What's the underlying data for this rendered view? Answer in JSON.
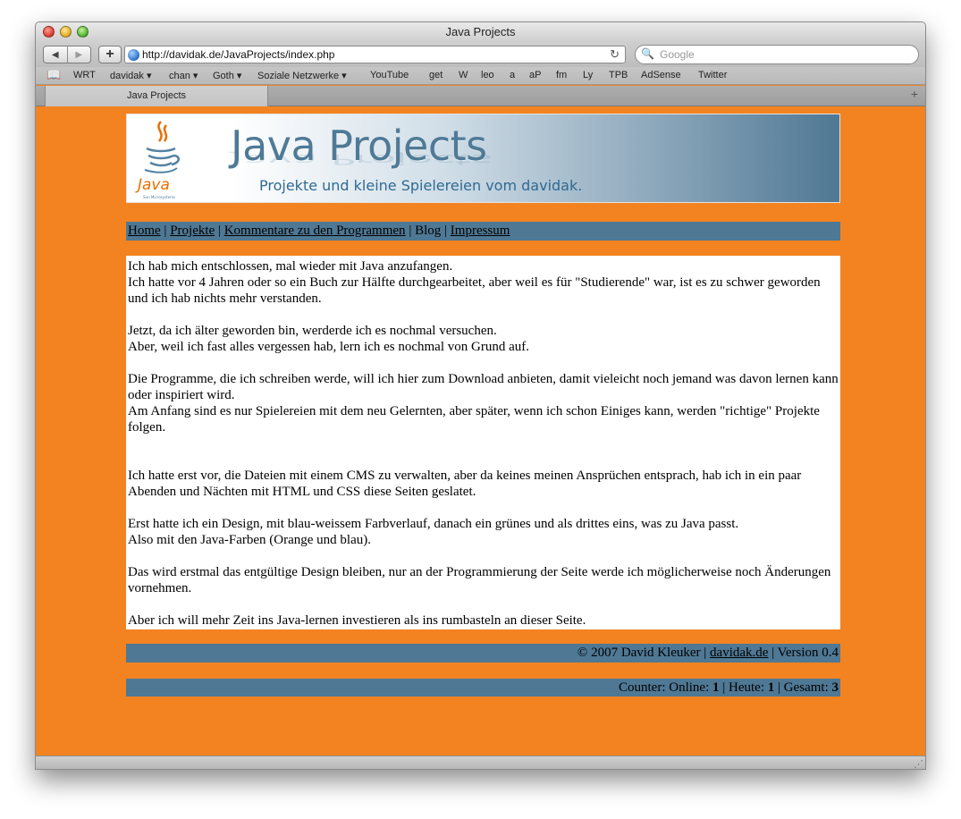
{
  "window": {
    "title": "Java Projects"
  },
  "toolbar": {
    "back_icon": "◀",
    "forward_icon": "▶",
    "add_icon": "+",
    "url": "http://davidak.de/JavaProjects/index.php",
    "reload_icon": "↻",
    "search_placeholder": "Google"
  },
  "bookmarks": [
    {
      "label": "WRT"
    },
    {
      "label": "davidak ▾"
    },
    {
      "label": "chan ▾"
    },
    {
      "label": "Goth ▾"
    },
    {
      "label": "Soziale Netzwerke ▾"
    },
    {
      "label": "YouTube"
    },
    {
      "label": "get"
    },
    {
      "label": "W"
    },
    {
      "label": "leo"
    },
    {
      "label": "a"
    },
    {
      "label": "aP"
    },
    {
      "label": "fm"
    },
    {
      "label": "Ly"
    },
    {
      "label": "TPB"
    },
    {
      "label": "AdSense"
    },
    {
      "label": "Twitter"
    }
  ],
  "tabs": [
    {
      "label": "Java Projects"
    }
  ],
  "banner": {
    "logo_text": "Java",
    "logo_small": "Sun Microsystems",
    "title": "Java Projects",
    "subtitle": "Projekte und kleine Spielereien vom davidak."
  },
  "nav": {
    "home": "Home",
    "projekte": "Projekte",
    "kommentare": "Kommentare zu den Programmen",
    "blog": "Blog",
    "impressum": "Impressum",
    "sep": " | "
  },
  "content": {
    "p1_l1": "Ich hab mich entschlossen, mal wieder mit Java anzufangen.",
    "p1_l2": "Ich hatte vor 4 Jahren oder so ein Buch zur Hälfte durchgearbeitet, aber weil es für \"Studierende\" war, ist es zu schwer geworden und ich hab nichts mehr verstanden.",
    "p2_l1": "Jetzt, da ich älter geworden bin, werderde ich es nochmal versuchen.",
    "p2_l2": "Aber, weil ich fast alles vergessen hab, lern ich es nochmal von Grund auf.",
    "p3_l1": "Die Programme, die ich schreiben werde, will ich hier zum Download anbieten, damit vieleicht noch jemand was davon lernen kann oder inspiriert wird.",
    "p3_l2": "Am Anfang sind es nur Spielereien mit dem neu Gelernten, aber später, wenn ich schon Einiges kann, werden \"richtige\" Projekte folgen.",
    "p4": "Ich hatte erst vor, die Dateien mit einem CMS zu verwalten, aber da keines meinen Ansprüchen entsprach, hab ich in ein paar Abenden und Nächten mit HTML und CSS diese Seiten geslatet.",
    "p5_l1": "Erst hatte ich ein Design, mit blau-weissem Farbverlauf, danach ein grünes und als drittes eins, was zu Java passt.",
    "p5_l2": "Also mit den Java-Farben (Orange und blau).",
    "p6": "Das wird erstmal das entgültige Design bleiben, nur an der Programmierung der Seite werde ich möglicherweise noch Änderungen vornehmen.",
    "p7": "Aber ich will mehr Zeit ins Java-lernen investieren als ins rumbasteln an dieser Seite."
  },
  "footer": {
    "copyright": "© 2007 David Kleuker | ",
    "link": "davidak.de",
    "version": " | Version 0.4"
  },
  "counter": {
    "online_label": "Counter: Online: ",
    "online": "1",
    "heute_label": " | Heute: ",
    "heute": "1",
    "gesamt_label": " | Gesamt: ",
    "gesamt": "3"
  },
  "colors": {
    "page_bg": "#f38321",
    "bar_blue": "#4f7894",
    "title_blue": "#4f7a97"
  }
}
